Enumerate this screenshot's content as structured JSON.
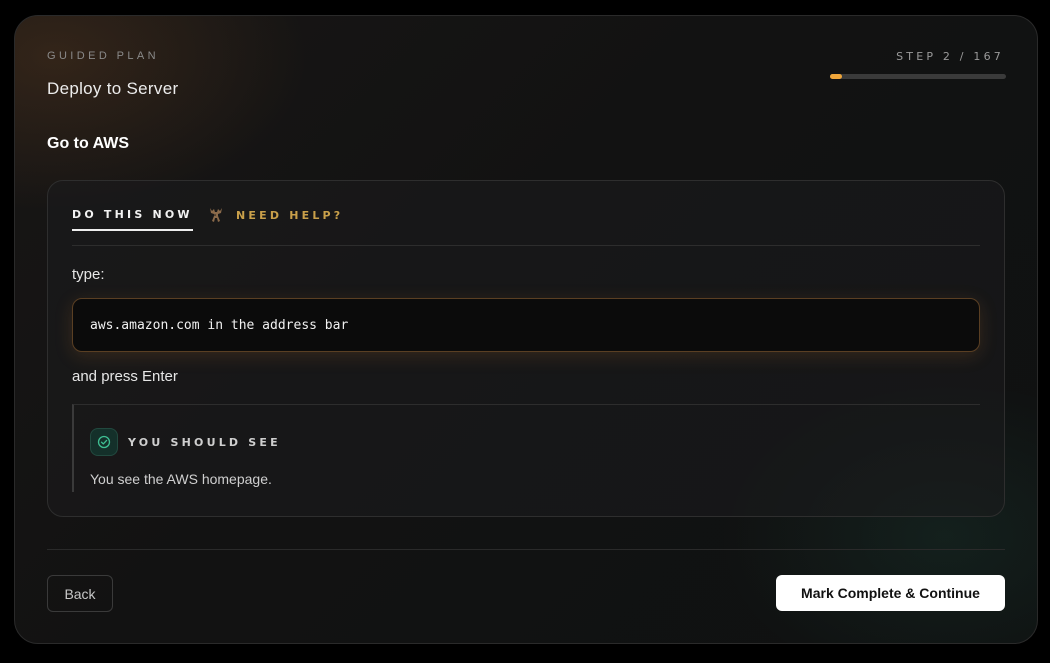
{
  "header": {
    "eyebrow": "GUIDED PLAN",
    "plan_title": "Deploy to Server",
    "step_label": "STEP 2 / 167",
    "progress": {
      "current": 2,
      "total": 167,
      "accent": "#f0a63a"
    }
  },
  "step": {
    "title": "Go to AWS"
  },
  "tabs": {
    "do_this_now": "DO THIS NOW",
    "need_help": "NEED HELP?",
    "help_icon": "moose-icon"
  },
  "instruction": {
    "before": "type:",
    "code": "aws.amazon.com in the address bar",
    "after": "and press Enter"
  },
  "expectation": {
    "icon": "check-circle-icon",
    "label": "YOU SHOULD SEE",
    "text": "You see the AWS homepage.",
    "accent": "#3fbf93"
  },
  "footer": {
    "back_label": "Back",
    "continue_label": "Mark Complete & Continue"
  }
}
